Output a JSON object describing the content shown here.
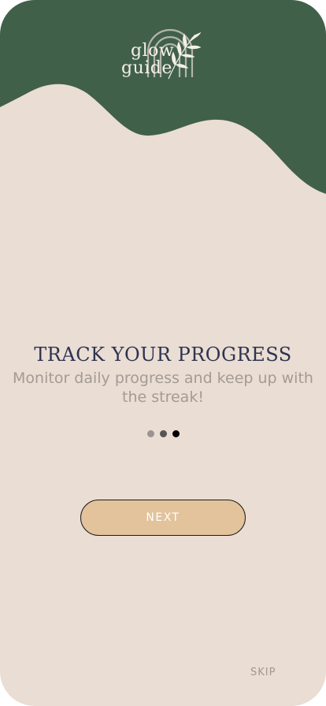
{
  "colors": {
    "background": "#eaddd3",
    "header_green": "#40604a",
    "title": "#2e3451",
    "subtitle": "#a39b95",
    "button_fill": "#e3c39c",
    "button_border": "#1d1d1d",
    "button_text": "#ffffff",
    "skip": "#9e9893",
    "dot_inactive": "#9b9490",
    "dot_mid": "#555555",
    "dot_active": "#000000"
  },
  "logo": {
    "line1": "glow",
    "line2": "guide",
    "icon": "rainbow-leaf-icon"
  },
  "onboarding": {
    "title": "TRACK YOUR PROGRESS",
    "subtitle": "Monitor daily progress and keep up with the streak!",
    "page_count": 3,
    "current_page": 3
  },
  "actions": {
    "next_label": "NEXT",
    "skip_label": "SKIP"
  }
}
